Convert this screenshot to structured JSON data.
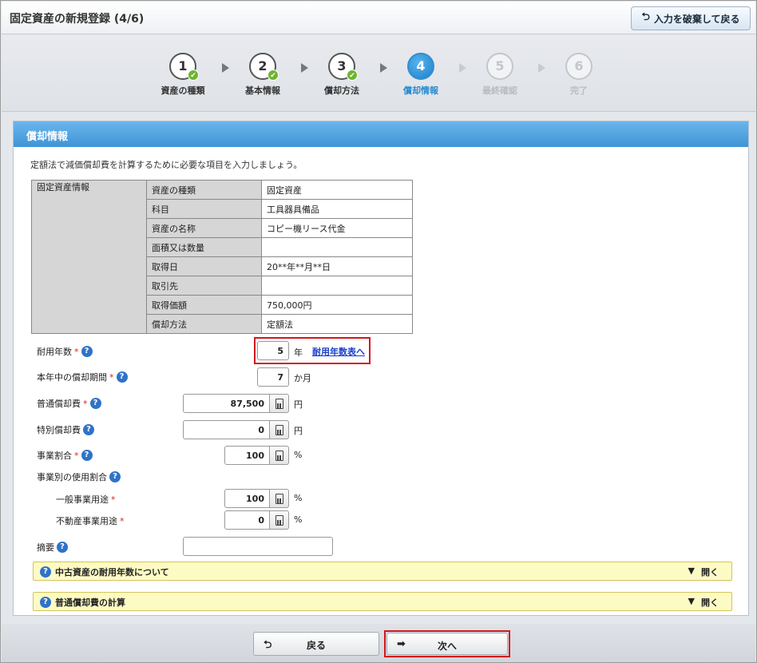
{
  "header": {
    "title": "固定資産の新規登録 (4/6)",
    "discard_label": "入力を破棄して戻る"
  },
  "steps": [
    {
      "num": "1",
      "label": "資産の種類",
      "state": "done"
    },
    {
      "num": "2",
      "label": "基本情報",
      "state": "done"
    },
    {
      "num": "3",
      "label": "償却方法",
      "state": "done"
    },
    {
      "num": "4",
      "label": "償却情報",
      "state": "current"
    },
    {
      "num": "5",
      "label": "最終確認",
      "state": "future"
    },
    {
      "num": "6",
      "label": "完了",
      "state": "future"
    }
  ],
  "panel": {
    "title": "償却情報",
    "intro": "定額法で減価償却費を計算するために必要な項目を入力しましょう。"
  },
  "asset_info": {
    "section_label": "固定資産情報",
    "rows": [
      {
        "key": "資産の種類",
        "value": "固定資産"
      },
      {
        "key": "科目",
        "value": "工具器具備品"
      },
      {
        "key": "資産の名称",
        "value": "コピー機リース代金"
      },
      {
        "key": "面積又は数量",
        "value": ""
      },
      {
        "key": "取得日",
        "value": "20**年**月**日"
      },
      {
        "key": "取引先",
        "value": ""
      },
      {
        "key": "取得価額",
        "value": "750,000円"
      },
      {
        "key": "償却方法",
        "value": "定額法"
      }
    ]
  },
  "form": {
    "useful_life": {
      "label": "耐用年数",
      "value": "5",
      "unit": "年",
      "link": "耐用年数表へ"
    },
    "months": {
      "label": "本年中の償却期間",
      "value": "7",
      "unit": "か月"
    },
    "normal_dep": {
      "label": "普通償却費",
      "value": "87,500",
      "unit": "円"
    },
    "special_dep": {
      "label": "特別償却費",
      "value": "0",
      "unit": "円"
    },
    "business_ratio": {
      "label": "事業割合",
      "value": "100",
      "unit": "%"
    },
    "usage_ratio_label": "事業別の使用割合",
    "general": {
      "label": "一般事業用途",
      "value": "100",
      "unit": "%"
    },
    "realestate": {
      "label": "不動産事業用途",
      "value": "0",
      "unit": "%"
    },
    "memo": {
      "label": "摘要",
      "value": ""
    },
    "required_mark": "*",
    "help_mark": "?"
  },
  "accordions": [
    {
      "title": "中古資産の耐用年数について",
      "open_label": "開く"
    },
    {
      "title": "普通償却費の計算",
      "open_label": "開く"
    }
  ],
  "footer": {
    "back_label": "戻る",
    "next_label": "次へ"
  },
  "colors": {
    "accent": "#3e94d6",
    "highlight_box": "#d3161e",
    "accordion_bg": "#fdfbc4"
  },
  "icons": {
    "discard": "return-arrow-icon",
    "check": "check-icon",
    "calculator": "calculator-icon",
    "help": "help-icon",
    "open": "triangle-down-icon",
    "back": "return-arrow-icon",
    "next": "right-arrow-icon"
  }
}
